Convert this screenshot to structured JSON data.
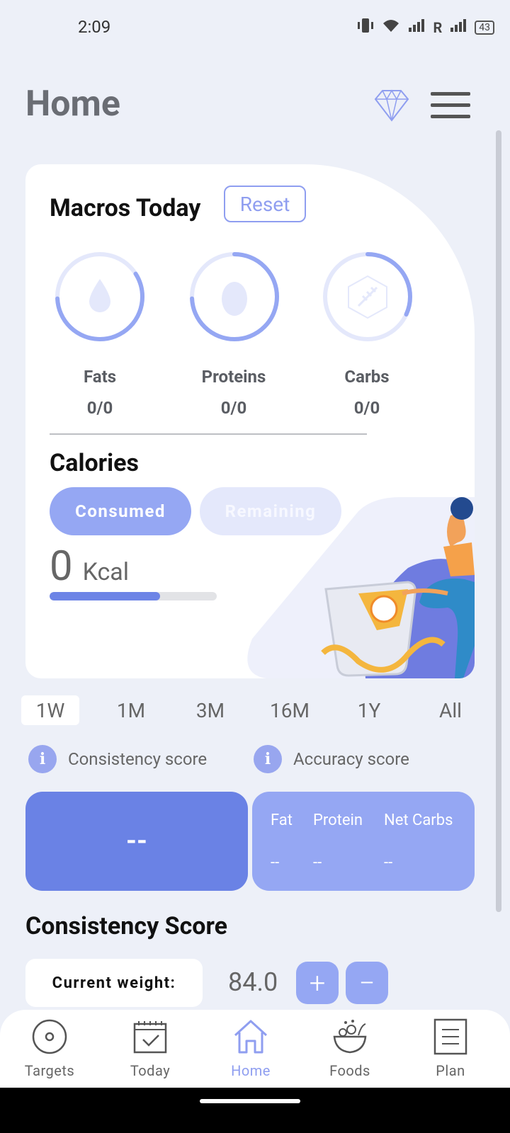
{
  "status_bar": {
    "time": "2:09",
    "battery": "43",
    "roaming": "R"
  },
  "header": {
    "title": "Home"
  },
  "macros": {
    "title": "Macros Today",
    "reset_label": "Reset",
    "items": [
      {
        "label": "Fats",
        "value": "0/0",
        "icon": "drop-icon"
      },
      {
        "label": "Proteins",
        "value": "0/0",
        "icon": "egg-icon"
      },
      {
        "label": "Carbs",
        "value": "0/0",
        "icon": "wheat-icon"
      }
    ]
  },
  "calories": {
    "title": "Calories",
    "consumed_label": "Consumed",
    "remaining_label": "Remaining",
    "value": "0",
    "unit": "Kcal",
    "progress_percent": 66
  },
  "range_tabs": [
    "1W",
    "1M",
    "3M",
    "16M",
    "1Y",
    "All"
  ],
  "range_selected": "1W",
  "info": {
    "consistency_label": "Consistency score",
    "accuracy_label": "Accuracy score",
    "info_glyph": "i"
  },
  "scores": {
    "main_value": "--",
    "columns": [
      {
        "label": "Fat",
        "value": "--"
      },
      {
        "label": "Protein",
        "value": "--"
      },
      {
        "label": "Net Carbs",
        "value": "--"
      }
    ]
  },
  "consistency": {
    "title": "Consistency Score",
    "weight_label": "Current weight:",
    "weight_value": "84.0",
    "plus": "+",
    "minus": "−"
  },
  "nav": [
    {
      "label": "Targets",
      "icon": "target-icon"
    },
    {
      "label": "Today",
      "icon": "calendar-check-icon"
    },
    {
      "label": "Home",
      "icon": "home-icon",
      "active": true
    },
    {
      "label": "Foods",
      "icon": "salad-bowl-icon"
    },
    {
      "label": "Plan",
      "icon": "plan-list-icon"
    }
  ],
  "colors": {
    "accent": "#95a7f3",
    "accent_dark": "#6a82e5",
    "background": "#edf0f8"
  }
}
